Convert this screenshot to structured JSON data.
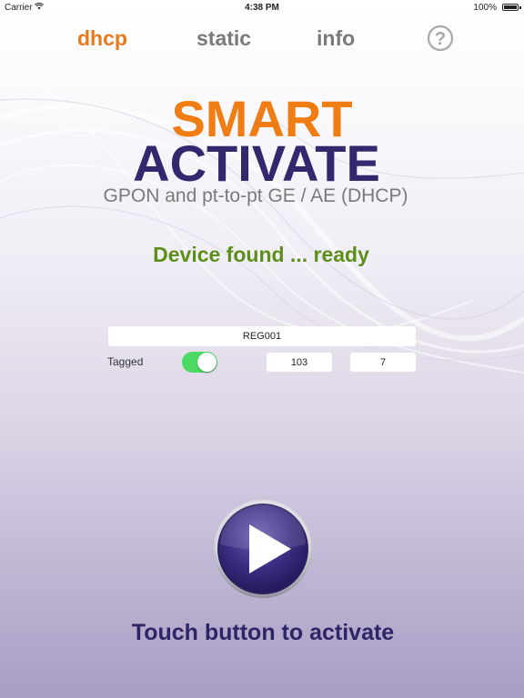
{
  "status_bar": {
    "carrier": "Carrier",
    "time": "4:38 PM",
    "battery_percent": "100%",
    "wifi_icon": "wifi-icon",
    "battery_icon": "battery-icon"
  },
  "tabs": [
    {
      "label": "dhcp",
      "active": true
    },
    {
      "label": "static",
      "active": false
    },
    {
      "label": "info",
      "active": false
    }
  ],
  "help": {
    "icon": "help-circle-icon",
    "glyph": "?"
  },
  "brand": {
    "line1": "SMART",
    "line2": "ACTIVATE",
    "subtitle": "GPON and pt-to-pt GE / AE (DHCP)"
  },
  "status_message": "Device found ... ready",
  "form": {
    "registration_id": "REG001",
    "tagged_label": "Tagged",
    "tagged_on": true,
    "vlan_id": "103",
    "priority": "7"
  },
  "action": {
    "play_icon": "play-icon",
    "prompt": "Touch button to activate"
  },
  "colors": {
    "accent_orange": "#ef7d14",
    "brand_purple": "#34276e",
    "status_green": "#5c8f1a",
    "toggle_green": "#4cd964"
  }
}
